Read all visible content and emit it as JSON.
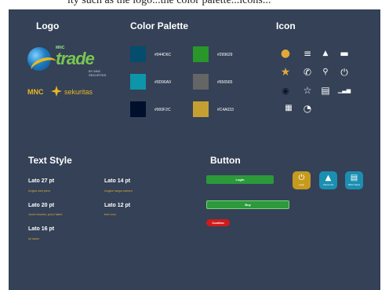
{
  "doc": {
    "top_caption": "ity such as the logo...the color palette...icons..."
  },
  "sections": {
    "logo": "Logo",
    "palette": "Color Palette",
    "icon": "Icon",
    "text_style": "Text Style",
    "button": "Button"
  },
  "logos": {
    "primary": {
      "small": "MNC",
      "big": "trade",
      "sub": "BY MNC SEKURITAS"
    },
    "secondary": {
      "left": "MNC",
      "right": "sekuritas"
    }
  },
  "palette": [
    {
      "hex": "#044D6C",
      "color": "#044D6C"
    },
    {
      "hex": "#299629",
      "color": "#299629"
    },
    {
      "hex": "#0D96A9",
      "color": "#0D96A9"
    },
    {
      "hex": "#656565",
      "color": "#656565"
    },
    {
      "hex": "#000F2C",
      "color": "#000F2C"
    },
    {
      "hex": "#C4A033",
      "color": "#C4A033"
    }
  ],
  "icons": {
    "account": "●",
    "menu": "≡",
    "person": "▲",
    "card": "▬",
    "star": "★",
    "phone": "✆",
    "search": "⚲",
    "power": "⏻",
    "eye": "◉",
    "star_outline": "☆",
    "document": "▤",
    "chart": "▁▃▅",
    "calculator": "▦",
    "pie": "◔"
  },
  "text_styles": {
    "lato27": {
      "name": "Lato 27 pt",
      "desc": "Angka last price"
    },
    "lato14": {
      "name": "Lato 14 pt",
      "desc": "Angka harga saham"
    },
    "lato20": {
      "name": "Lato 20 pt",
      "desc": "Judul header, judul tabel"
    },
    "lato12": {
      "name": "Lato 12 pt",
      "desc": "text icon"
    },
    "lato16": {
      "name": "Lato 16 pt",
      "desc": "Isi tabel"
    }
  },
  "buttons": {
    "login": "Login",
    "buy": "Buy",
    "confirm": "Confirm",
    "tile1": "Login",
    "tile2": "Client Info",
    "tile3": "MNC News"
  }
}
